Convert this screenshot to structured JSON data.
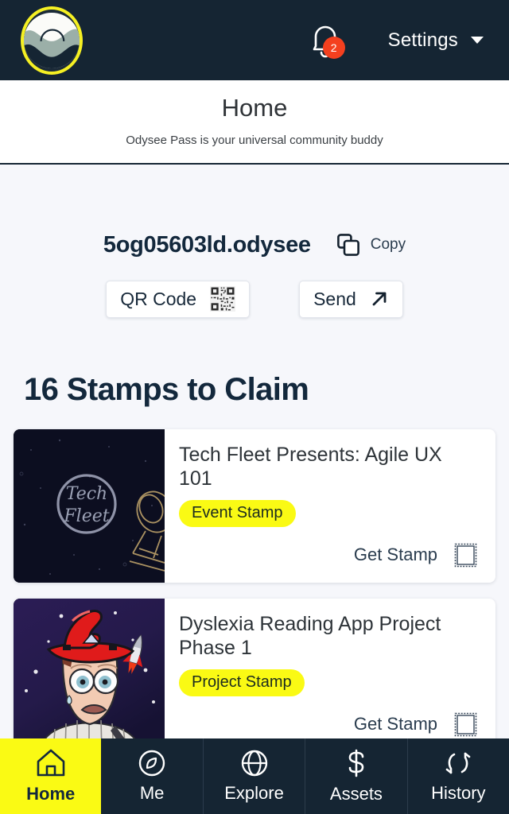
{
  "header": {
    "logo_name": "odysee-logo",
    "notifications": {
      "icon": "bell-icon",
      "count": "2"
    },
    "settings_label": "Settings",
    "caret_icon": "chevron-down-icon",
    "bg_color": "#152533",
    "accent_color": "#fafa14",
    "badge_color": "#f4401f"
  },
  "page": {
    "title": "Home",
    "subtitle": "Odysee Pass is your universal community buddy"
  },
  "wallet": {
    "address": "5og05603ld.odysee",
    "copy_icon": "copy-icon",
    "copy_label": "Copy",
    "qr_button_label": "QR Code",
    "qr_icon": "qr-code-icon",
    "send_button_label": "Send",
    "send_icon": "arrow-up-right-icon"
  },
  "stamps": {
    "heading": "16 Stamps to Claim",
    "items": [
      {
        "title": "Tech Fleet Presents: Agile UX 101",
        "badge": "Event Stamp",
        "action_label": "Get Stamp",
        "action_icon": "postage-stamp-icon",
        "thumbnail": "tech-fleet-space-telescope"
      },
      {
        "title": "Dyslexia Reading App Project Phase 1",
        "badge": "Project Stamp",
        "action_label": "Get Stamp",
        "action_icon": "postage-stamp-icon",
        "thumbnail": "wizard-astronaut-rocket"
      }
    ]
  },
  "bottom_nav": {
    "items": [
      {
        "label": "Home",
        "icon": "home-icon",
        "active": true
      },
      {
        "label": "Me",
        "icon": "compass-icon",
        "active": false
      },
      {
        "label": "Explore",
        "icon": "globe-icon",
        "active": false
      },
      {
        "label": "Assets",
        "icon": "dollar-icon",
        "active": false
      },
      {
        "label": "History",
        "icon": "refresh-icon",
        "active": false
      }
    ]
  }
}
